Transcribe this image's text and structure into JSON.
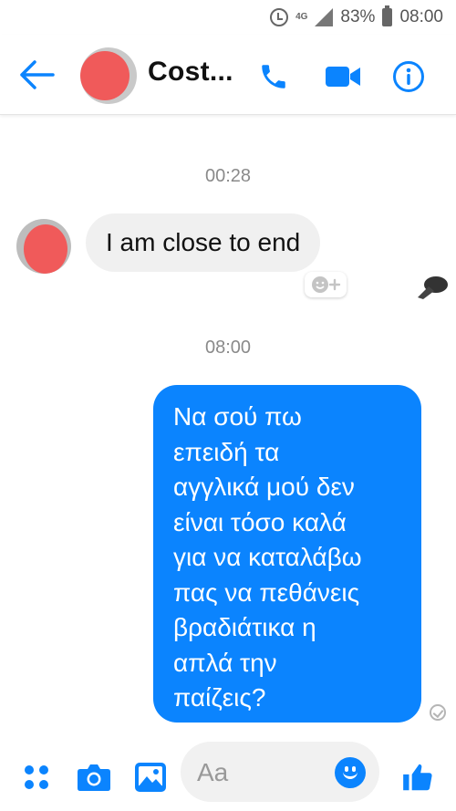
{
  "status_bar": {
    "network": "4G",
    "battery": "83%",
    "time": "08:00"
  },
  "header": {
    "contact_name": "Cost..."
  },
  "conversation": {
    "timestamp_1": "00:28",
    "incoming_message": "I am close to end",
    "timestamp_2": "08:00",
    "outgoing_message_lines": [
      "Να σού πω",
      "επειδή τα",
      "αγγλικά μού δεν",
      "είναι τόσο καλά",
      "για να καταλάβω",
      "πας να πεθάνεις",
      "βραδιάτικα η",
      "απλά την",
      "παίζεις?"
    ]
  },
  "composer": {
    "placeholder": "Aa"
  },
  "colors": {
    "accent": "#0b84fe",
    "incoming_bubble": "#f0f0f0",
    "avatar_redaction": "#f05a5a"
  },
  "icons": {
    "back": "arrow-left-icon",
    "call": "phone-icon",
    "video": "video-camera-icon",
    "info": "info-icon",
    "more": "four-dots-icon",
    "camera": "camera-icon",
    "gallery": "image-icon",
    "emoji": "smiley-icon",
    "like": "thumbs-up-icon",
    "react": "add-reaction-icon",
    "delivered": "check-circle-icon"
  }
}
